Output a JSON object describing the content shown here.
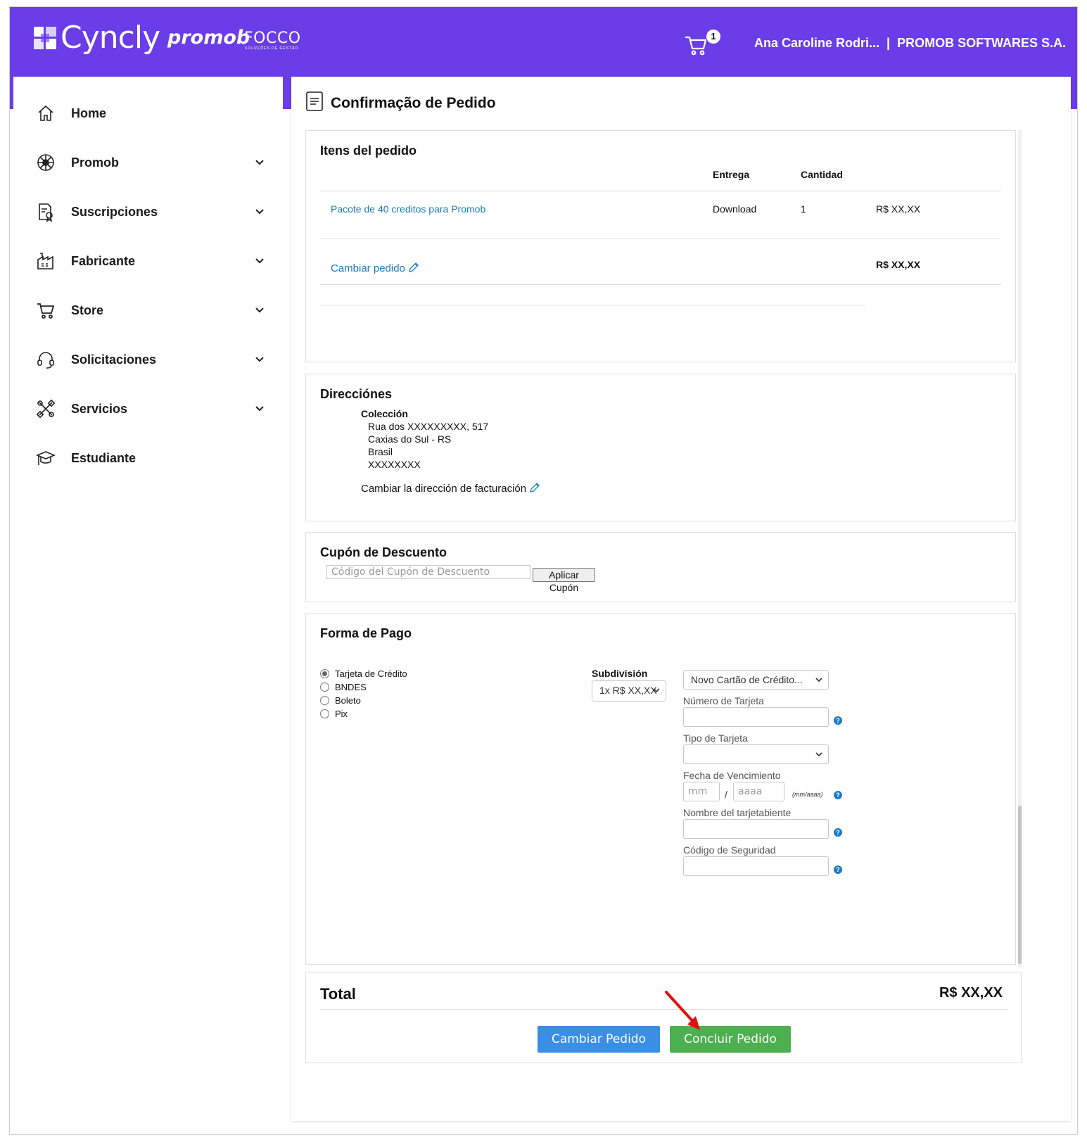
{
  "header": {
    "brand": "Cyncly",
    "brand_promob": "promob",
    "brand_focco": "FOCCO",
    "brand_focco_sub": "SOLUÇÕES DE GESTÃO",
    "cart_icon": "cart-icon",
    "cart_count": "1",
    "user_label": "Ana Caroline Rodri...  |  PROMOB SOFTWARES S.A.",
    "accent_color": "#6a3de8"
  },
  "sidebar": {
    "items": [
      {
        "label": "Home",
        "icon": "home-icon"
      },
      {
        "label": "Promob",
        "icon": "promob-icon"
      },
      {
        "label": "Suscripciones",
        "icon": "subscription-icon"
      },
      {
        "label": "Fabricante",
        "icon": "factory-icon"
      },
      {
        "label": "Store",
        "icon": "cart-icon"
      },
      {
        "label": "Solicitaciones",
        "icon": "headset-icon"
      },
      {
        "label": "Servicios",
        "icon": "tools-icon"
      },
      {
        "label": "Estudiante",
        "icon": "graduation-cap-icon"
      }
    ]
  },
  "page": {
    "title": "Confirmação de Pedido",
    "title_icon": "document-icon"
  },
  "items": {
    "title": "Itens del pedido",
    "col_delivery": "Entrega",
    "col_quantity": "Cantidad",
    "rows": [
      {
        "name": "Pacote de 40 creditos para Promob",
        "delivery": "Download",
        "quantity": "1",
        "price": "R$ XX,XX"
      }
    ],
    "change_link": "Cambiar pedido",
    "subtotal": "R$ XX,XX"
  },
  "addresses": {
    "title": "Direcciónes",
    "subtitle": "Colección",
    "line1": "Rua dos XXXXXXXXX, 517",
    "line2": "Caxias do Sul - RS",
    "line3": "Brasil",
    "line4": "XXXXXXXX",
    "change_link": "Cambiar la dirección de facturación"
  },
  "coupon": {
    "title": "Cupón de Descuento",
    "placeholder": "Código del Cupón de Descuento",
    "apply_label": "Aplicar Cupón"
  },
  "payment": {
    "title": "Forma de Pago",
    "methods": [
      "Tarjeta de Crédito",
      "BNDES",
      "Boleto",
      "Pix"
    ],
    "selected_method": "Tarjeta de Crédito",
    "subdivision_label": "Subdivisión",
    "subdivision_value": "1x R$ XX,XX",
    "card_select_value": "Novo Cartão de Crédito...",
    "card_number_label": "Número de Tarjeta",
    "card_type_label": "Tipo de Tarjeta",
    "expiry_label": "Fecha de Vencimiento",
    "expiry_month_placeholder": "mm",
    "expiry_separator": "/",
    "expiry_year_placeholder": "aaaa",
    "expiry_format": "(mm/aaaa)",
    "holder_label": "Nombre del tarjetabiente",
    "cvv_label": "Código de Seguridad",
    "help_glyph": "?"
  },
  "total": {
    "label": "Total",
    "value": "R$ XX,XX"
  },
  "actions": {
    "change_label": "Cambiar Pedido",
    "change_color": "#3a8ee6",
    "conclude_label": "Concluir Pedido",
    "conclude_color": "#4caf50"
  }
}
